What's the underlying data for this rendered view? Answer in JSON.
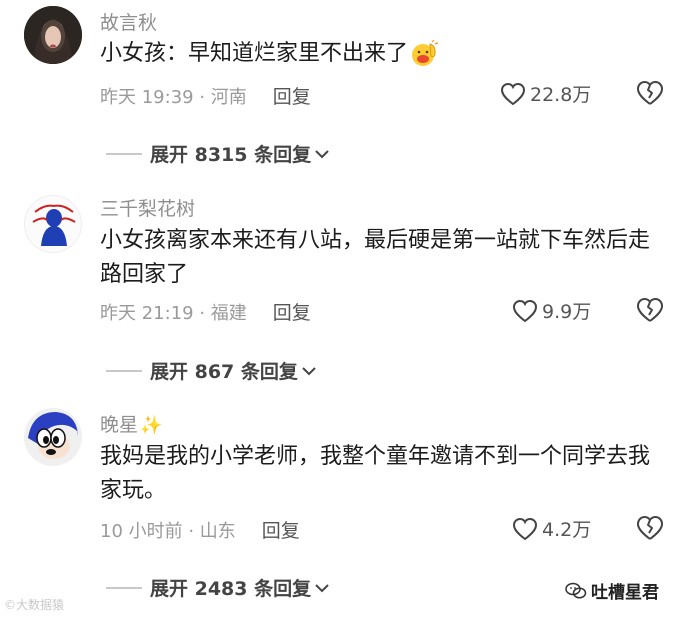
{
  "comments": [
    {
      "username": "故言秋",
      "content": "小女孩：早知道烂家里不出来了",
      "content_emoji": "waving-face-emoji",
      "time_location": "昨天 19:39 · 河南",
      "reply_label": "回复",
      "likes": "22.8万",
      "expand_label": "展开 8315 条回复"
    },
    {
      "username": "三千梨花树",
      "content": "小女孩离家本来还有八站，最后硬是第一站就下车然后走路回家了",
      "time_location": "昨天 21:19 · 福建",
      "reply_label": "回复",
      "likes": "9.9万",
      "expand_label": "展开 867 条回复"
    },
    {
      "username": "晚星",
      "username_emoji": "✨",
      "content": "我妈是我的小学老师，我整个童年邀请不到一个同学去我家玩。",
      "time_location": "10 小时前 · 山东",
      "reply_label": "回复",
      "likes": "4.2万",
      "expand_label": "展开 2483 条回复"
    }
  ],
  "watermarks": {
    "left": "©大数据猿",
    "right": "吐槽星君"
  },
  "colors": {
    "username": "#8f8f8f",
    "content": "#1c1c1c",
    "meta": "#9a9a9a",
    "expand": "#444444"
  }
}
